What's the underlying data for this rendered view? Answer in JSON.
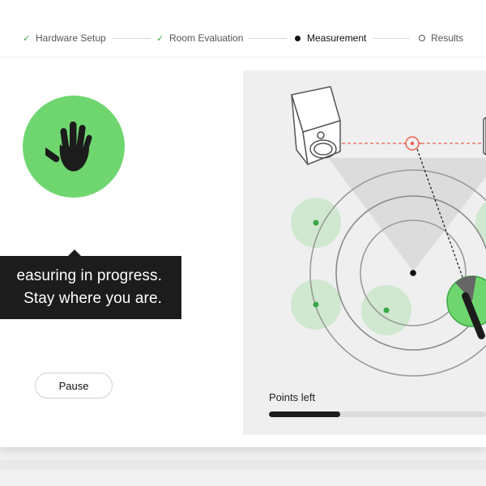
{
  "stepper": {
    "steps": [
      {
        "label": "Hardware Setup",
        "state": "done"
      },
      {
        "label": "Room Evaluation",
        "state": "done"
      },
      {
        "label": "Measurement",
        "state": "active"
      },
      {
        "label": "Results",
        "state": "pending"
      }
    ]
  },
  "status": {
    "line1": "easuring in progress.",
    "line2": "Stay where you are."
  },
  "controls": {
    "pause_label": "Pause"
  },
  "measurement": {
    "points_left_label": "Points left",
    "progress_fraction": 0.33
  },
  "colors": {
    "accent_green": "#6fd66f",
    "point_green": "#3aa845",
    "target_red": "#e8604c",
    "dark": "#1c1c1c"
  },
  "icons": {
    "hand": "hand-stop-icon",
    "speaker": "speaker-icon",
    "target": "crosshair-target-icon",
    "microphone": "microphone-icon"
  }
}
